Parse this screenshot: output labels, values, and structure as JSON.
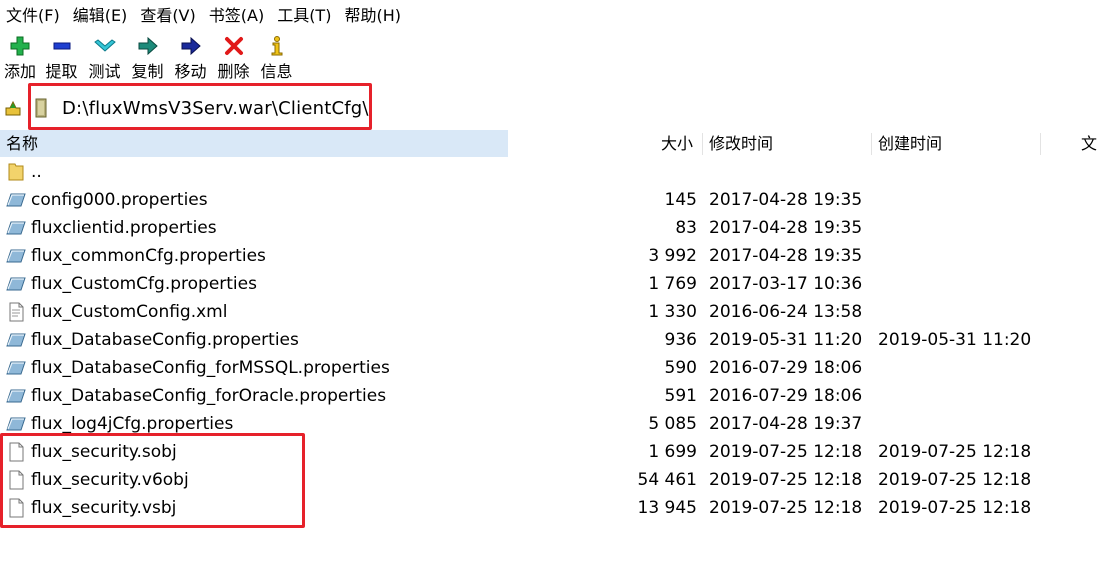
{
  "menu": [
    "文件(F)",
    "编辑(E)",
    "查看(V)",
    "书签(A)",
    "工具(T)",
    "帮助(H)"
  ],
  "toolbar": [
    {
      "label": "添加",
      "icon": "plus-icon"
    },
    {
      "label": "提取",
      "icon": "minus-icon"
    },
    {
      "label": "测试",
      "icon": "check-icon"
    },
    {
      "label": "复制",
      "icon": "copy-arrow-icon"
    },
    {
      "label": "移动",
      "icon": "move-arrow-icon"
    },
    {
      "label": "删除",
      "icon": "delete-x-icon"
    },
    {
      "label": "信息",
      "icon": "info-icon"
    }
  ],
  "address": {
    "path": "D:\\fluxWmsV3Serv.war\\ClientCfg\\"
  },
  "columns": {
    "name": "名称",
    "size": "大小",
    "modified": "修改时间",
    "created": "创建时间",
    "extra": "文"
  },
  "files": [
    {
      "name": "..",
      "size": "",
      "modified": "",
      "created": "",
      "type": "folder"
    },
    {
      "name": "config000.properties",
      "size": "145",
      "modified": "2017-04-28 19:35",
      "created": "",
      "type": "properties"
    },
    {
      "name": "fluxclientid.properties",
      "size": "83",
      "modified": "2017-04-28 19:35",
      "created": "",
      "type": "properties"
    },
    {
      "name": "flux_commonCfg.properties",
      "size": "3 992",
      "modified": "2017-04-28 19:35",
      "created": "",
      "type": "properties"
    },
    {
      "name": "flux_CustomCfg.properties",
      "size": "1 769",
      "modified": "2017-03-17 10:36",
      "created": "",
      "type": "properties"
    },
    {
      "name": "flux_CustomConfig.xml",
      "size": "1 330",
      "modified": "2016-06-24 13:58",
      "created": "",
      "type": "xml"
    },
    {
      "name": "flux_DatabaseConfig.properties",
      "size": "936",
      "modified": "2019-05-31 11:20",
      "created": "2019-05-31 11:20",
      "type": "properties"
    },
    {
      "name": "flux_DatabaseConfig_forMSSQL.properties",
      "size": "590",
      "modified": "2016-07-29 18:06",
      "created": "",
      "type": "properties"
    },
    {
      "name": "flux_DatabaseConfig_forOracle.properties",
      "size": "591",
      "modified": "2016-07-29 18:06",
      "created": "",
      "type": "properties"
    },
    {
      "name": "flux_log4jCfg.properties",
      "size": "5 085",
      "modified": "2017-04-28 19:37",
      "created": "",
      "type": "properties"
    },
    {
      "name": "flux_security.sobj",
      "size": "1 699",
      "modified": "2019-07-25 12:18",
      "created": "2019-07-25 12:18",
      "type": "file"
    },
    {
      "name": "flux_security.v6obj",
      "size": "54 461",
      "modified": "2019-07-25 12:18",
      "created": "2019-07-25 12:18",
      "type": "file"
    },
    {
      "name": "flux_security.vsbj",
      "size": "13 945",
      "modified": "2019-07-25 12:18",
      "created": "2019-07-25 12:18",
      "type": "file"
    }
  ],
  "colors": {
    "highlight": "#e6212a",
    "header_selected": "#d9e8f7"
  }
}
